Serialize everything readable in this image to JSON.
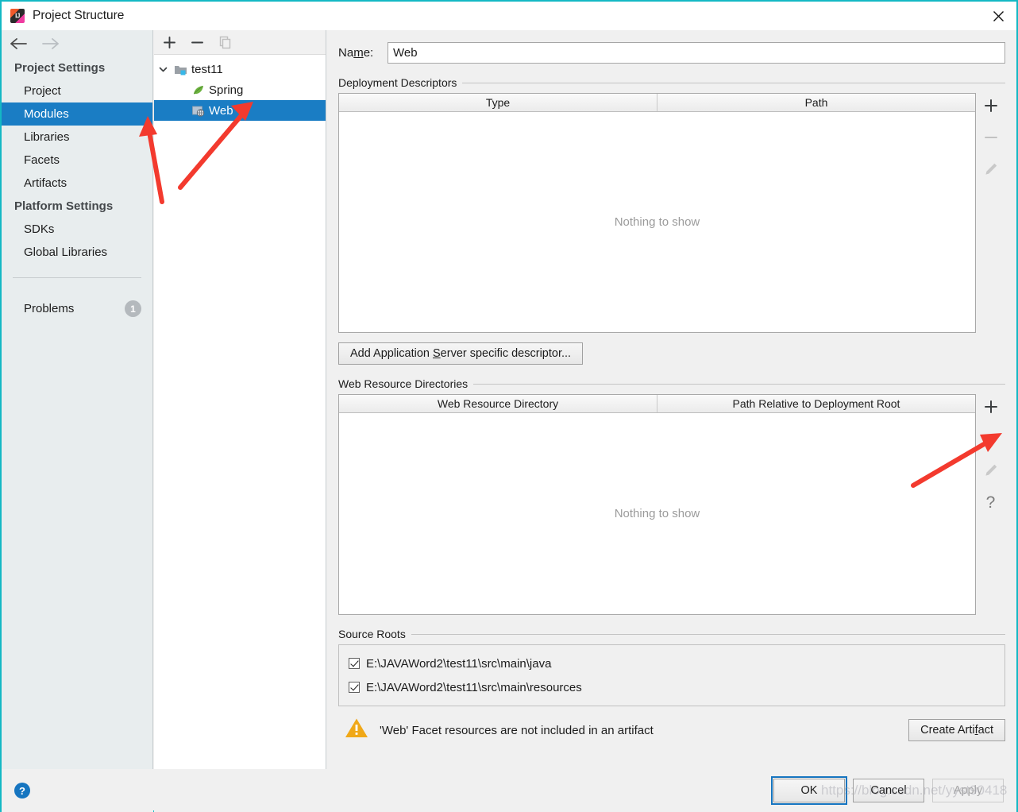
{
  "window": {
    "title": "Project Structure",
    "app_icon": "intellij-idea-icon",
    "close_icon": "close-icon"
  },
  "sidebar": {
    "back_icon": "arrow-left-icon",
    "forward_icon": "arrow-right-icon",
    "groups": [
      {
        "header": "Project Settings",
        "items": [
          {
            "label": "Project",
            "selected": false
          },
          {
            "label": "Modules",
            "selected": true
          },
          {
            "label": "Libraries",
            "selected": false
          },
          {
            "label": "Facets",
            "selected": false
          },
          {
            "label": "Artifacts",
            "selected": false
          }
        ]
      },
      {
        "header": "Platform Settings",
        "items": [
          {
            "label": "SDKs",
            "selected": false
          },
          {
            "label": "Global Libraries",
            "selected": false
          }
        ]
      }
    ],
    "problems": {
      "label": "Problems",
      "badge": "1"
    },
    "help_icon": "help-circle-icon",
    "help_glyph": "?"
  },
  "tree": {
    "toolbar": [
      {
        "name": "add-module-button",
        "glyph": "+",
        "enabled": true
      },
      {
        "name": "remove-module-button",
        "glyph": "−",
        "enabled": true
      },
      {
        "name": "copy-module-button",
        "glyph": "copy-icon",
        "enabled": false
      }
    ],
    "nodes": [
      {
        "label": "test11",
        "icon": "module-folder-icon",
        "level": 0,
        "expanded": true,
        "selected": false
      },
      {
        "label": "Spring",
        "icon": "spring-leaf-icon",
        "level": 1,
        "selected": false
      },
      {
        "label": "Web",
        "icon": "web-facet-icon",
        "level": 1,
        "selected": true
      }
    ]
  },
  "main": {
    "name_field": {
      "label_pre": "Na",
      "label_mnemonic": "m",
      "label_post": "e:",
      "value": "Web"
    },
    "deployment_descriptors": {
      "title": "Deployment Descriptors",
      "columns": [
        "Type",
        "Path"
      ],
      "rows": [],
      "empty_text": "Nothing to show",
      "tools": [
        {
          "name": "add-descriptor-button",
          "glyph": "+",
          "enabled": true
        },
        {
          "name": "remove-descriptor-button",
          "glyph": "−",
          "enabled": false
        },
        {
          "name": "edit-descriptor-button",
          "glyph": "pencil-icon",
          "enabled": false
        }
      ],
      "add_button": {
        "pre": "Add Application ",
        "mnemonic": "S",
        "post": "erver specific descriptor..."
      }
    },
    "web_resource_directories": {
      "title": "Web Resource Directories",
      "columns": [
        "Web Resource Directory",
        "Path Relative to Deployment Root"
      ],
      "rows": [],
      "empty_text": "Nothing to show",
      "tools": [
        {
          "name": "add-web-resource-button",
          "glyph": "+",
          "enabled": true
        },
        {
          "name": "remove-web-resource-button",
          "glyph": "−",
          "enabled": false
        },
        {
          "name": "edit-web-resource-button",
          "glyph": "pencil-icon",
          "enabled": false
        },
        {
          "name": "help-web-resource-button",
          "glyph": "?",
          "enabled": true
        }
      ]
    },
    "source_roots": {
      "title": "Source Roots",
      "items": [
        {
          "label": "E:\\JAVAWord2\\test11\\src\\main\\java",
          "checked": true
        },
        {
          "label": "E:\\JAVAWord2\\test11\\src\\main\\resources",
          "checked": true
        }
      ]
    },
    "warning": {
      "icon": "warning-triangle-icon",
      "text": "'Web' Facet resources are not included in an artifact",
      "action_button": {
        "pre": "Create Arti",
        "mnemonic": "f",
        "post": "act"
      }
    }
  },
  "footer": {
    "ok": "OK",
    "cancel": "Cancel",
    "apply": "Apply"
  },
  "watermark": "https://blog.csdn.net/yyst90418",
  "colors": {
    "selection_blue": "#1a7dc4",
    "window_border": "#14b8c4",
    "warning_amber": "#f0a818",
    "annotation_red": "#f33a2e",
    "help_blue": "#1675c0"
  }
}
